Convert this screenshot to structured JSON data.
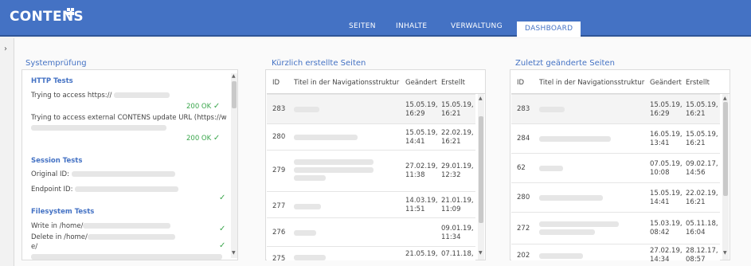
{
  "app": {
    "brand": "CONTENS"
  },
  "nav": {
    "items": [
      "SEITEN",
      "INHALTE",
      "VERWALTUNG",
      "DASHBOARD"
    ],
    "active": "DASHBOARD"
  },
  "system_check": {
    "title": "Systemprüfung",
    "http": {
      "heading": "HTTP Tests",
      "line1": "Trying to access https://",
      "status1": "200 OK",
      "line2": "Trying to access external CONTENS update URL (https://w",
      "status2": "200 OK"
    },
    "session": {
      "heading": "Session Tests",
      "original": "Original ID:",
      "endpoint": "Endpoint ID:"
    },
    "filesystem": {
      "heading": "Filesystem Tests",
      "write": "Write in /home/",
      "delete": "Delete in /home/",
      "cont": "e/"
    }
  },
  "created": {
    "title": "Kürzlich erstellte Seiten",
    "columns": {
      "id": "ID",
      "title": "Titel in der Navigationsstruktur",
      "changed": "Geändert",
      "created": "Erstellt"
    },
    "rows": [
      {
        "id": "283",
        "changed": [
          "15.05.19,",
          "16:29"
        ],
        "created": [
          "15.05.19,",
          "16:21"
        ]
      },
      {
        "id": "280",
        "changed": [
          "15.05.19,",
          "14:41"
        ],
        "created": [
          "22.02.19,",
          "16:21"
        ]
      },
      {
        "id": "279",
        "changed": [
          "27.02.19,",
          "11:38"
        ],
        "created": [
          "29.01.19,",
          "12:32"
        ]
      },
      {
        "id": "277",
        "changed": [
          "14.03.19,",
          "11:51"
        ],
        "created": [
          "21.01.19,",
          "11:09"
        ]
      },
      {
        "id": "276",
        "changed": [
          "",
          ""
        ],
        "created": [
          "09.01.19,",
          "11:34"
        ]
      },
      {
        "id": "275",
        "changed": [
          "21.05.19,",
          ""
        ],
        "created": [
          "07.11.18,",
          ""
        ]
      }
    ]
  },
  "modified": {
    "title": "Zuletzt geänderte Seiten",
    "columns": {
      "id": "ID",
      "title": "Titel in der Navigationsstruktur",
      "changed": "Geändert",
      "created": "Erstellt"
    },
    "rows": [
      {
        "id": "283",
        "changed": [
          "15.05.19,",
          "16:29"
        ],
        "created": [
          "15.05.19,",
          "16:21"
        ]
      },
      {
        "id": "284",
        "changed": [
          "16.05.19,",
          "13:41"
        ],
        "created": [
          "15.05.19,",
          "16:21"
        ]
      },
      {
        "id": "62",
        "changed": [
          "07.05.19,",
          "10:08"
        ],
        "created": [
          "09.02.17,",
          "14:56"
        ]
      },
      {
        "id": "280",
        "changed": [
          "15.05.19,",
          "14:41"
        ],
        "created": [
          "22.02.19,",
          "16:21"
        ]
      },
      {
        "id": "272",
        "changed": [
          "15.03.19,",
          "08:42"
        ],
        "created": [
          "05.11.18,",
          "16:04"
        ]
      },
      {
        "id": "202",
        "changed": [
          "27.02.19,",
          "14:34"
        ],
        "created": [
          "28.12.17,",
          "08:57"
        ]
      }
    ]
  },
  "colors": {
    "brand_blue": "#4472c4",
    "ok_green": "#3aa64c"
  }
}
